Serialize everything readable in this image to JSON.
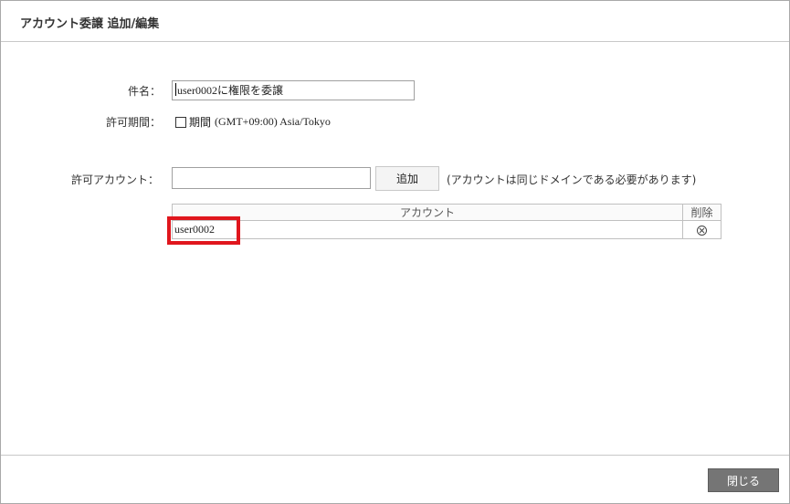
{
  "dialog": {
    "title": "アカウント委譲 追加/編集"
  },
  "form": {
    "subject_label": "件名：",
    "subject_value": "user0002に権限を委譲",
    "period_label": "許可期間：",
    "period_checkbox_label": "期間",
    "period_checked": false,
    "timezone": "(GMT+09:00) Asia/Tokyo",
    "account_label": "許可アカウント：",
    "account_value": "",
    "add_button_label": "追加",
    "note": "(アカウントは同じドメインである必要があります)"
  },
  "accounts_table": {
    "columns": [
      "アカウント",
      "削除"
    ],
    "rows": [
      {
        "account": "user0002",
        "delete_icon": "circle-x-icon"
      }
    ]
  },
  "highlight": {
    "color": "#e0161d"
  },
  "footer": {
    "close_button_label": "閉じる"
  }
}
